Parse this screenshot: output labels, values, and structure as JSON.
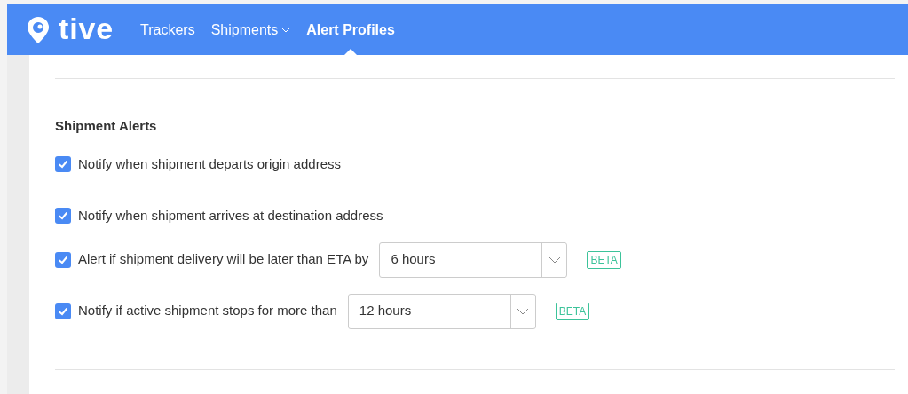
{
  "header": {
    "logo": "tive",
    "nav": [
      {
        "label": "Trackers",
        "selected": false,
        "dropdown": false
      },
      {
        "label": "Shipments",
        "selected": false,
        "dropdown": true
      },
      {
        "label": "Alert Profiles",
        "selected": true,
        "dropdown": false
      }
    ]
  },
  "section": {
    "title": "Shipment Alerts",
    "alerts": [
      {
        "kind": "plain",
        "label": "Notify when shipment departs origin address",
        "checked": true
      },
      {
        "kind": "plain",
        "label": "Notify when shipment arrives at destination address",
        "checked": true
      },
      {
        "kind": "select",
        "label": "Alert if shipment delivery will be later than ETA by",
        "checked": true,
        "value": "6 hours",
        "badge": "BETA"
      },
      {
        "kind": "select",
        "label": "Notify if active shipment stops for more than",
        "checked": true,
        "value": "12 hours",
        "badge": "BETA"
      }
    ]
  }
}
